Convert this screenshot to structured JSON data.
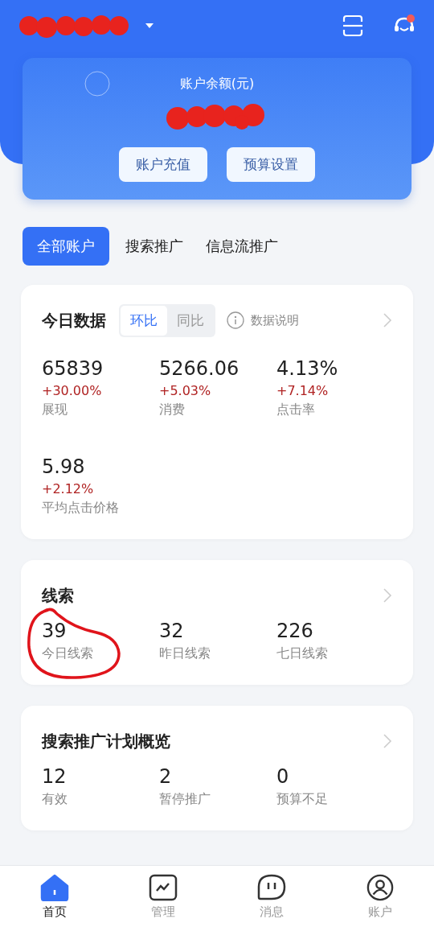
{
  "header": {
    "balance_label": "账户余额(元)",
    "buttons": [
      "账户充值",
      "预算设置"
    ]
  },
  "account_tabs": [
    {
      "label": "全部账户",
      "selected": true
    },
    {
      "label": "搜索推广",
      "selected": false
    },
    {
      "label": "信息流推广",
      "selected": false
    }
  ],
  "today": {
    "title": "今日数据",
    "compare": [
      {
        "label": "环比",
        "selected": true
      },
      {
        "label": "同比",
        "selected": false
      }
    ],
    "info_link": "数据说明",
    "metrics": [
      {
        "value": "65839",
        "change": "+30.00%",
        "label": "展现"
      },
      {
        "value": "5266.06",
        "change": "+5.03%",
        "label": "消费"
      },
      {
        "value": "4.13%",
        "change": "+7.14%",
        "label": "点击率"
      },
      {
        "value": "5.98",
        "change": "+2.12%",
        "label": "平均点击价格"
      }
    ]
  },
  "leads": {
    "title": "线索",
    "metrics": [
      {
        "value": "39",
        "label": "今日线索"
      },
      {
        "value": "32",
        "label": "昨日线索"
      },
      {
        "value": "226",
        "label": "七日线索"
      }
    ]
  },
  "plans": {
    "title": "搜索推广计划概览",
    "metrics": [
      {
        "value": "12",
        "label": "有效"
      },
      {
        "value": "2",
        "label": "暂停推广"
      },
      {
        "value": "0",
        "label": "预算不足"
      }
    ]
  },
  "bottom_nav": [
    {
      "label": "首页",
      "selected": true
    },
    {
      "label": "管理",
      "selected": false
    },
    {
      "label": "消息",
      "selected": false
    },
    {
      "label": "账户",
      "selected": false
    }
  ]
}
